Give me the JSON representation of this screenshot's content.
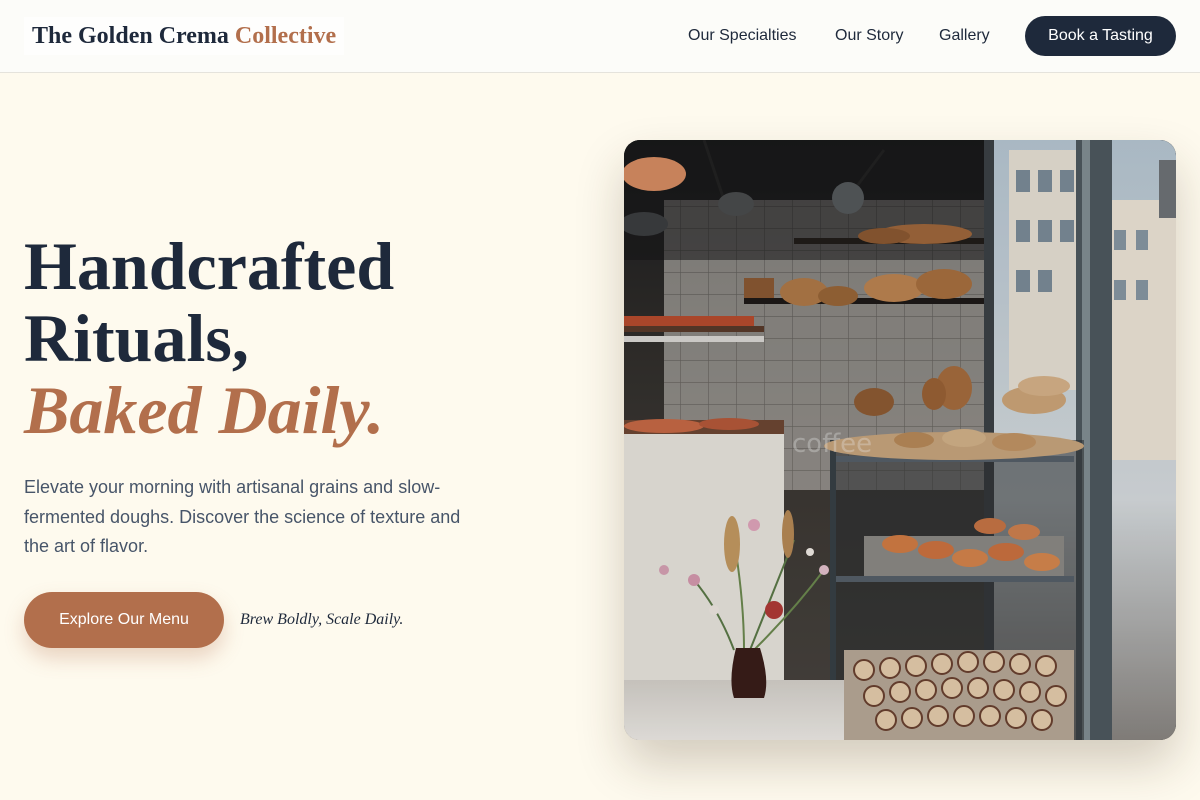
{
  "header": {
    "brand_main": "The Golden Crema",
    "brand_accent": "Collective",
    "nav": [
      {
        "label": "Our Specialties"
      },
      {
        "label": "Our Story"
      },
      {
        "label": "Gallery"
      }
    ],
    "cta_label": "Book a Tasting"
  },
  "hero": {
    "title_line1": "Handcrafted",
    "title_line2": "Rituals,",
    "title_line3": "Baked Daily.",
    "description": "Elevate your morning with artisanal grains and slow-fermented doughs. Discover the science of texture and the art of flavor.",
    "primary_cta": "Explore Our Menu",
    "tagline": "Brew Boldly, Scale Daily.",
    "image_window_text": "coffee"
  },
  "colors": {
    "background": "#fefaee",
    "navy": "#1e293b",
    "accent": "#b26f4c",
    "body_text": "#475569"
  }
}
